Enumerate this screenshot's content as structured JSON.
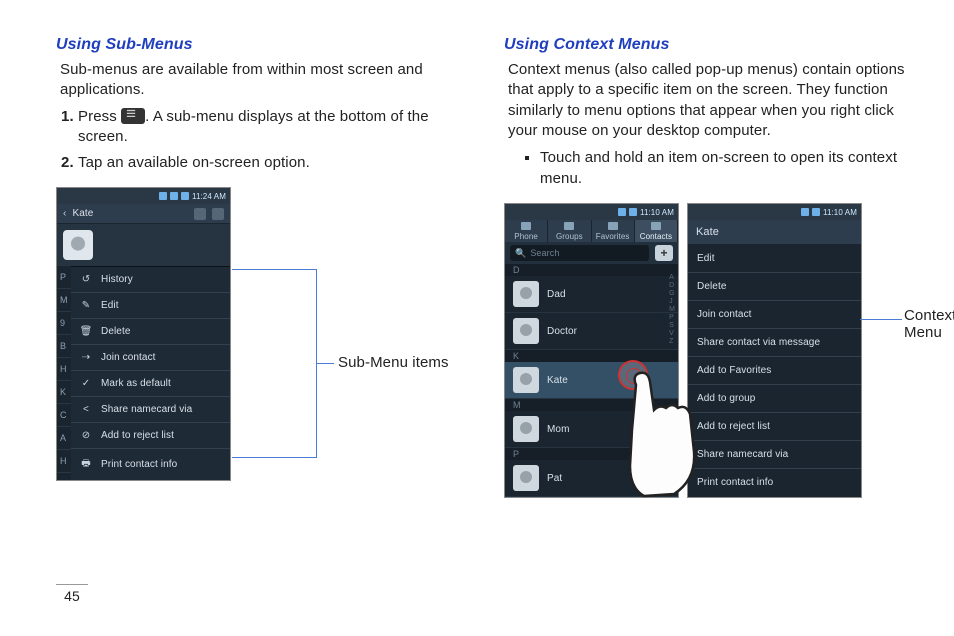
{
  "page_number": "45",
  "left": {
    "heading": "Using Sub-Menus",
    "intro": "Sub-menus are available from within most screen and applications.",
    "step1_before": "Press ",
    "step1_after": ". A sub-menu displays at the bottom of the screen.",
    "step2": "Tap an available on-screen option.",
    "phone": {
      "time": "11:24 AM",
      "title": "Kate",
      "submenu": [
        {
          "icon": "↺",
          "label": "History"
        },
        {
          "icon": "✎",
          "label": "Edit"
        },
        {
          "icon": "🗑",
          "label": "Delete"
        },
        {
          "icon": "⇢",
          "label": "Join contact"
        },
        {
          "icon": "✓",
          "label": "Mark as default"
        },
        {
          "icon": "<",
          "label": "Share namecard via"
        },
        {
          "icon": "⊘",
          "label": "Add to reject list"
        },
        {
          "icon": "🖶",
          "label": "Print contact info"
        }
      ],
      "behind_letters": [
        "P",
        "M",
        "9",
        "B",
        "H",
        "K",
        "C",
        "A",
        "H"
      ]
    },
    "callout": "Sub-Menu items"
  },
  "right": {
    "heading": "Using Context Menus",
    "intro": "Context menus (also called pop-up menus) contain options that apply to a specific item on the screen. They function similarly to menu options that appear when you right click your mouse on your desktop computer.",
    "bullet": "Touch and hold an item on-screen to open its context menu.",
    "phone_list": {
      "time": "11:10 AM",
      "tabs": [
        "Phone",
        "Groups",
        "Favorites",
        "Contacts"
      ],
      "search_placeholder": "Search",
      "sections": [
        {
          "letter": "D",
          "rows": [
            "Dad",
            "Doctor"
          ]
        },
        {
          "letter": "K",
          "rows": [
            "Kate"
          ]
        },
        {
          "letter": "M",
          "rows": [
            "Mom"
          ]
        },
        {
          "letter": "P",
          "rows": [
            "Pat"
          ]
        }
      ]
    },
    "phone_ctx": {
      "time": "11:10 AM",
      "title": "Kate",
      "items": [
        "Edit",
        "Delete",
        "Join contact",
        "Share contact via message",
        "Add to Favorites",
        "Add to group",
        "Add to reject list",
        "Share namecard via",
        "Print contact info"
      ]
    },
    "callout": "Context Menu"
  }
}
